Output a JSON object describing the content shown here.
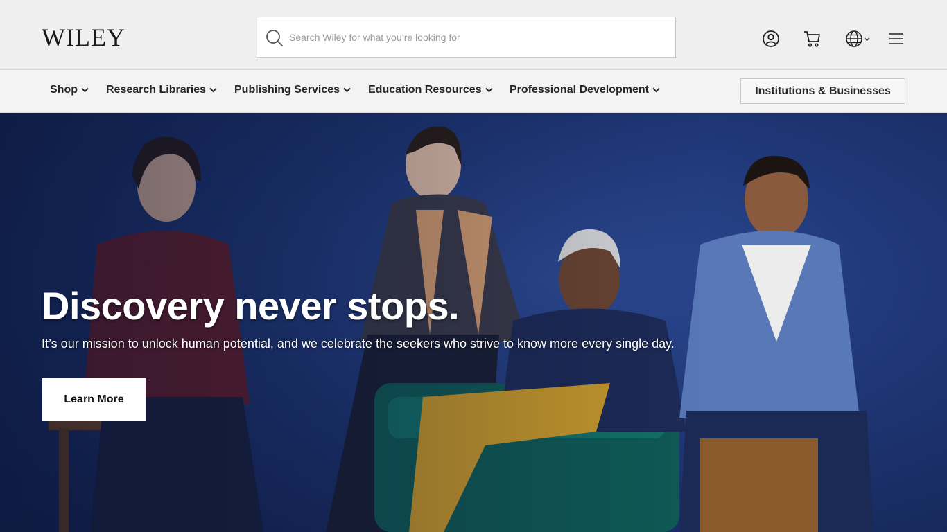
{
  "header": {
    "logo_text": "WILEY",
    "search": {
      "placeholder": "Search Wiley for what you’re looking for"
    },
    "icons": [
      "account-icon",
      "cart-icon",
      "globe-icon",
      "menu-icon"
    ]
  },
  "nav": {
    "items": [
      {
        "label": "Shop"
      },
      {
        "label": "Research Libraries"
      },
      {
        "label": "Publishing Services"
      },
      {
        "label": "Education Resources"
      },
      {
        "label": "Professional Development"
      }
    ],
    "cta_label": "Institutions & Businesses"
  },
  "hero": {
    "title": "Discovery never stops.",
    "subtitle": "It’s our mission to unlock human potential, and we celebrate the seekers who strive to know more every single day.",
    "button_label": "Learn More"
  },
  "colors": {
    "header_bg": "#efefef",
    "nav_bg": "#f3f3f3",
    "hero_bg": "#1f3777",
    "text": "#1a1a1a"
  }
}
